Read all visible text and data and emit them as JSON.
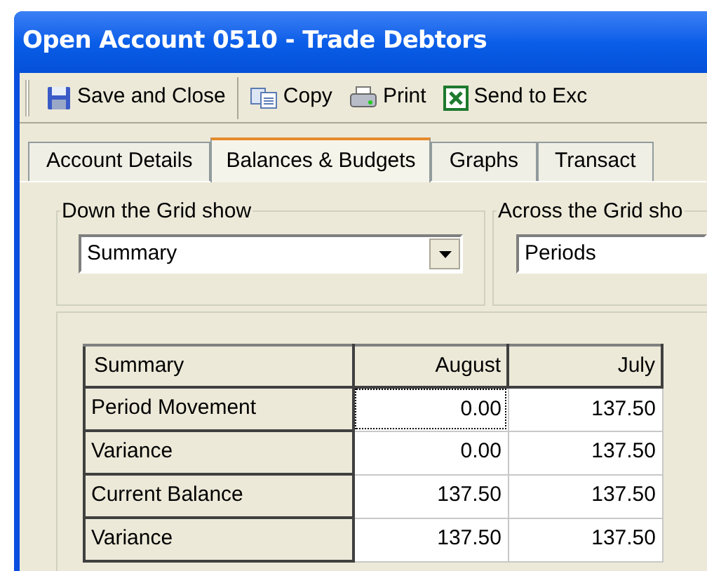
{
  "window": {
    "title": "Open Account 0510 - Trade Debtors"
  },
  "toolbar": [
    {
      "label": "Save and Close",
      "kind": "save"
    },
    {
      "label": "Copy",
      "kind": "copy"
    },
    {
      "label": "Print",
      "kind": "print"
    },
    {
      "label": "Send to Exc",
      "kind": "excel"
    }
  ],
  "tabs": [
    {
      "label": "Account Details",
      "selected": false
    },
    {
      "label": "Balances & Budgets",
      "selected": true
    },
    {
      "label": "Graphs",
      "selected": false
    },
    {
      "label": "Transact",
      "selected": false
    }
  ],
  "down_group": {
    "label": "Down the Grid show",
    "value": "Summary"
  },
  "across_group": {
    "label": "Across the Grid sho",
    "value": "Periods"
  },
  "grid": {
    "columns": [
      "Summary",
      "August",
      "July"
    ],
    "rows": [
      {
        "cells": [
          {
            "text": "Period Movement",
            "focused": false
          },
          {
            "text": "0.00",
            "focused": true
          },
          {
            "text": "137.50",
            "focused": false
          }
        ]
      },
      {
        "cells": [
          {
            "text": "Variance",
            "focused": false
          },
          {
            "text": "0.00",
            "focused": false
          },
          {
            "text": "137.50",
            "focused": false
          }
        ]
      },
      {
        "cells": [
          {
            "text": "Current Balance",
            "focused": false
          },
          {
            "text": "137.50",
            "focused": false
          },
          {
            "text": "137.50",
            "focused": false
          }
        ]
      },
      {
        "cells": [
          {
            "text": "Variance",
            "focused": false
          },
          {
            "text": "137.50",
            "focused": false
          },
          {
            "text": "137.50",
            "focused": false
          }
        ]
      }
    ]
  }
}
